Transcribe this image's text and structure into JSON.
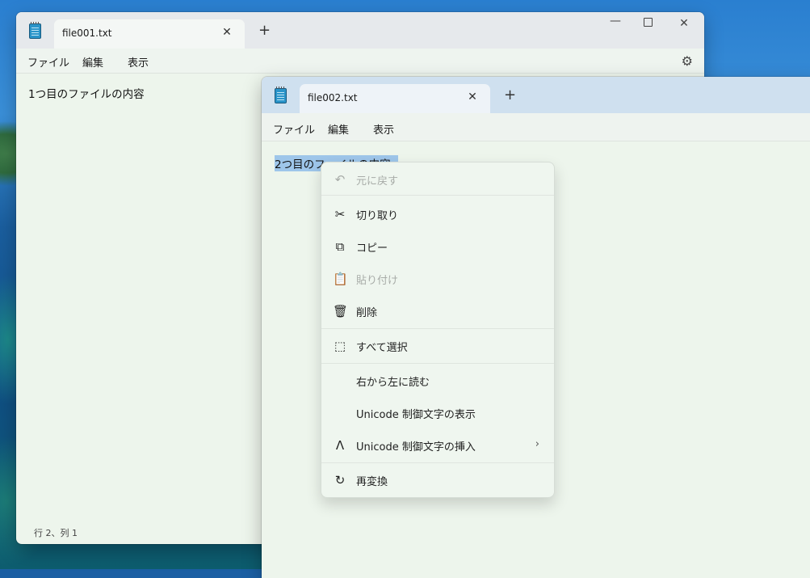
{
  "window1": {
    "tab_title": "file001.txt",
    "close_tab": "✕",
    "add_tab": "+",
    "minimize": "—",
    "close": "✕",
    "menu": [
      "ファイル",
      "編集",
      "表示"
    ],
    "settings_icon": "gear-icon",
    "content": "1つ目のファイルの内容",
    "status": "行 2、列 1"
  },
  "window2": {
    "tab_title": "file002.txt",
    "close_tab": "✕",
    "add_tab": "+",
    "menu": [
      "ファイル",
      "編集",
      "表示"
    ],
    "content": "2つ目のファイルの内容"
  },
  "context_menu": {
    "items": [
      {
        "label": "元に戻す",
        "icon": "undo-icon",
        "glyph": "↶",
        "enabled": false
      },
      {
        "label": "切り取り",
        "icon": "scissors-icon",
        "glyph": "✂",
        "enabled": true
      },
      {
        "label": "コピー",
        "icon": "copy-icon",
        "glyph": "⧉",
        "enabled": true
      },
      {
        "label": "貼り付け",
        "icon": "paste-icon",
        "glyph": "📋",
        "enabled": false
      },
      {
        "label": "削除",
        "icon": "trash-icon",
        "glyph": "🗑",
        "enabled": true
      },
      {
        "label": "すべて選択",
        "icon": "select-all-icon",
        "glyph": "⬚",
        "enabled": true
      },
      {
        "label": "右から左に読む",
        "icon": "",
        "glyph": "",
        "enabled": true
      },
      {
        "label": "Unicode 制御文字の表示",
        "icon": "",
        "glyph": "",
        "enabled": true
      },
      {
        "label": "Unicode 制御文字の挿入",
        "icon": "insert-caret-icon",
        "glyph": "Λ",
        "enabled": true,
        "submenu": "›"
      },
      {
        "label": "再変換",
        "icon": "reconvert-icon",
        "glyph": "↻",
        "enabled": true
      }
    ]
  },
  "colors": {
    "editor_bg": "#edf5ec",
    "selection": "#9ec6ea",
    "titlebar_active": "#cfe0ef"
  }
}
